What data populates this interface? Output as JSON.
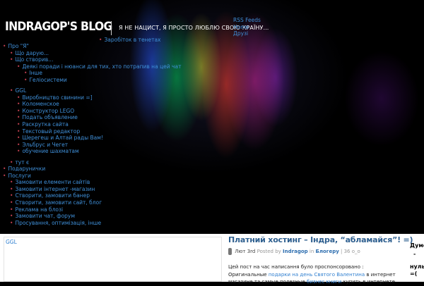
{
  "header": {
    "logo": "INDRAGOP'S BLOG",
    "tagline": "Я НЕ НАЦИСТ, Я ПРОСТО ЛЮБЛЮ СВОЮ КРАЇНУ..."
  },
  "top_nav": [
    "RSS Feeds",
    "Home",
    "Друзі"
  ],
  "earn_link": "Заробіток в тенетах",
  "side_menu": {
    "about": "Про \"Я\"",
    "give": "Що дарую...",
    "created": "Що створив...",
    "created_sub": {
      "tips": "Деякі поради і нюанси для тих, хто потрапив на цей чат",
      "other": "Інше",
      "helio": "Геліосистеми"
    },
    "ggl": "GGL",
    "ggl_sub": [
      "Виробництво свинини =]",
      "Коломенское",
      "Конструктор LEGO",
      "Подать объявление",
      "Раскрутка сайта",
      "Текстовый редактор",
      "Шерегеш и Алтай рады Вам!",
      "Эльбрус и Чегет",
      "обучение шахматам"
    ],
    "here": "тут є",
    "gifts": "Подарунички",
    "services": "Послуги",
    "services_sub": [
      "Замовити елементи сайтів",
      "Замовити інтернет -магазин",
      "Створити, замовити банер",
      "Створити, замовити сайт, блог",
      "Реклама на блозі",
      "Замовити чат, форум",
      "Просування, оптимізація, інше"
    ]
  },
  "sidebar_box": {
    "title": "GGL"
  },
  "post": {
    "title": "Платний хостинг – Індра, “абламайся”! =)",
    "date": "Лют 3rd",
    "posted_by": "Posted by",
    "author": "Indragop",
    "in_word": "in",
    "category": "Блогеру",
    "comments": "36 ο_ο",
    "body_line1": "Цей пост на час написання було проспонсоровано :",
    "body_pre": "Оригинальные",
    "link1": "подарки на день Святого Валентина",
    "body_mid": "в интернет магазине та самые полезные",
    "link2": "бизнес книги",
    "body_post": "купить в интернете"
  },
  "right_col": [
    "Думс",
    "-",
    "нуль",
    "=("
  ]
}
